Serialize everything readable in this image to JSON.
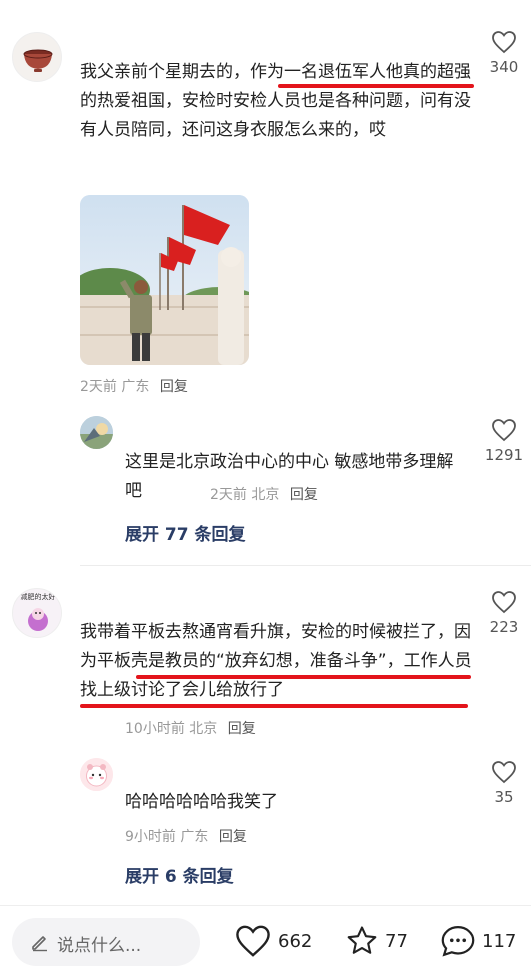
{
  "comments": [
    {
      "text": "我父亲前个星期去的，作为一名退伍军人他真的超强的热爱祖国，安检时安检人员也是各种问题，问有没有人员陪同，还问这身衣服怎么来的，哎",
      "time": "2天前",
      "location": "广东",
      "reply_label": "回复",
      "likes": "340",
      "avatar_icon": "bowl-avatar-icon",
      "reply": {
        "text": "这里是北京政治中心的中心 敏感地带多理解吧",
        "time": "2天前",
        "location": "北京",
        "reply_label": "回复",
        "likes": "1291"
      },
      "expand_label": "展开 77 条回复"
    },
    {
      "text": "我带着平板去熬通宵看升旗，安检的时候被拦了，因为平板壳是教员的“放弃幻想，准备斗争”，工作人员找上级讨论了会儿给放行了",
      "time": "10小时前",
      "location": "北京",
      "reply_label": "回复",
      "likes": "223",
      "avatar_caption": "减肥的太好",
      "reply": {
        "text": "哈哈哈哈哈哈我笑了",
        "time": "9小时前",
        "location": "广东",
        "reply_label": "回复",
        "likes": "35"
      },
      "expand_label": "展开 6 条回复"
    }
  ],
  "bottom_bar": {
    "input_placeholder": "说点什么...",
    "likes": "662",
    "favorites": "77",
    "comments": "117"
  },
  "colors": {
    "highlight_underline": "#e3141b",
    "expand_link": "#2a3d66",
    "meta_text": "#999999"
  }
}
